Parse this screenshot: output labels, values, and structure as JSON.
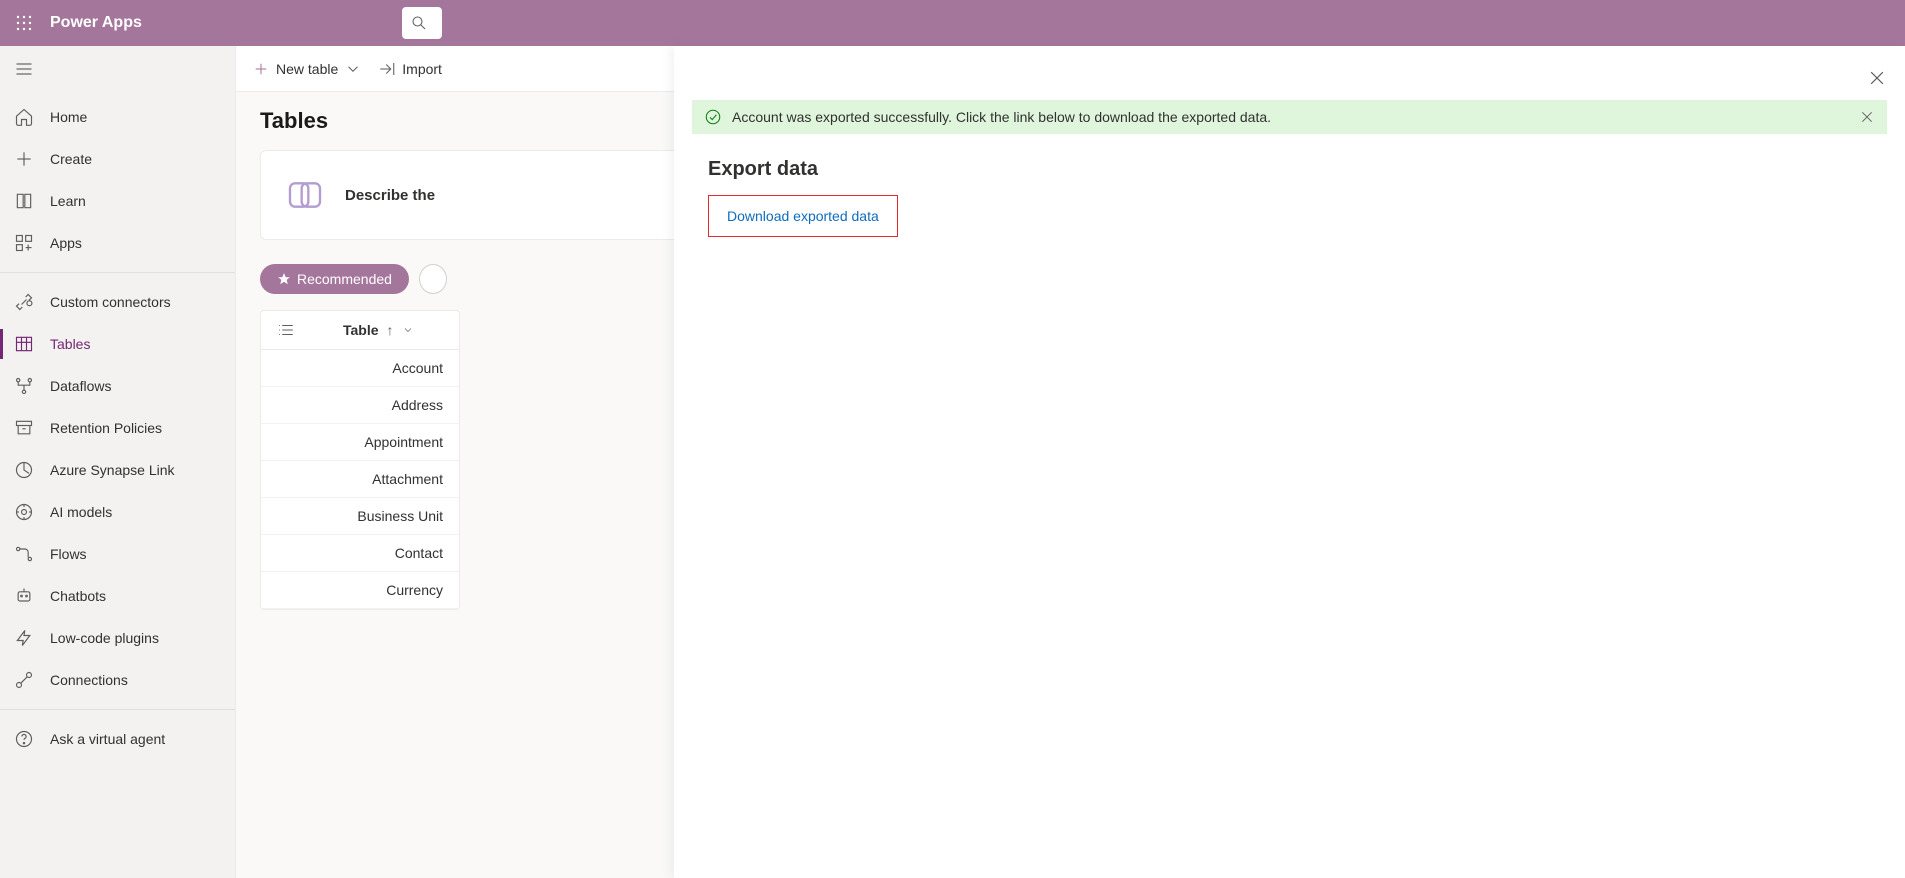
{
  "header": {
    "app_title": "Power Apps"
  },
  "sidebar": {
    "items": [
      {
        "label": "Home"
      },
      {
        "label": "Create"
      },
      {
        "label": "Learn"
      },
      {
        "label": "Apps"
      },
      {
        "label": "Custom connectors"
      },
      {
        "label": "Tables"
      },
      {
        "label": "Dataflows"
      },
      {
        "label": "Retention Policies"
      },
      {
        "label": "Azure Synapse Link"
      },
      {
        "label": "AI models"
      },
      {
        "label": "Flows"
      },
      {
        "label": "Chatbots"
      },
      {
        "label": "Low-code plugins"
      },
      {
        "label": "Connections"
      },
      {
        "label": "Ask a virtual agent"
      }
    ]
  },
  "cmdbar": {
    "new_table": "New table",
    "import": "Import"
  },
  "page": {
    "title": "Tables",
    "describe": "Describe the",
    "pill_active": "Recommended",
    "col_header": "Table",
    "rows": [
      {
        "name": "Account"
      },
      {
        "name": "Address"
      },
      {
        "name": "Appointment"
      },
      {
        "name": "Attachment"
      },
      {
        "name": "Business Unit"
      },
      {
        "name": "Contact"
      },
      {
        "name": "Currency"
      }
    ]
  },
  "flyout": {
    "notice": "Account was exported successfully. Click the link below to download the exported data.",
    "heading": "Export data",
    "download_label": "Download exported data"
  }
}
